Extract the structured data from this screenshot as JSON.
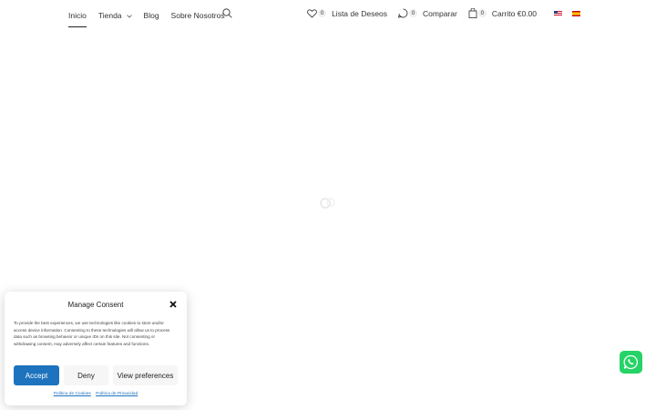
{
  "nav": {
    "items": [
      {
        "label": "Inicio"
      },
      {
        "label": "Tienda"
      },
      {
        "label": "Blog"
      },
      {
        "label": "Sobre Nosotros"
      }
    ]
  },
  "tools": {
    "wishlist": {
      "count": "0",
      "label": "Lista de Deseos"
    },
    "compare": {
      "count": "0",
      "label": "Comparar"
    },
    "cart": {
      "count": "0",
      "label": "Carrito",
      "total": "€0.00"
    }
  },
  "languages": [
    "en-flag-icon",
    "es-flag-icon"
  ],
  "consent": {
    "title": "Manage Consent",
    "text": "To provide the best experiences, we use technologies like cookies to store and/or access device information. Consenting to these technologies will allow us to process data such as browsing behavior or unique IDs on this site. Not consenting or withdrawing consent, may adversely affect certain features and functions.",
    "accept_label": "Accept",
    "deny_label": "Deny",
    "prefs_label": "View preferences",
    "links": [
      "Política de Cookies",
      "Política de Privacidad"
    ]
  },
  "colors": {
    "accent": "#1e73be",
    "whatsapp": "#25d366"
  }
}
